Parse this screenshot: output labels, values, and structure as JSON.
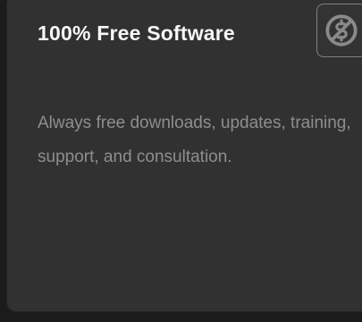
{
  "card": {
    "title": "100% Free Software",
    "description": "Always free downloads, updates, training, support, and consultation.",
    "icon": "no-money-icon"
  },
  "colors": {
    "background": "#1b1b1b",
    "card": "#313131",
    "title": "#f7f7f7",
    "description": "#8e8e8e",
    "icon": "#8a8a8a"
  }
}
